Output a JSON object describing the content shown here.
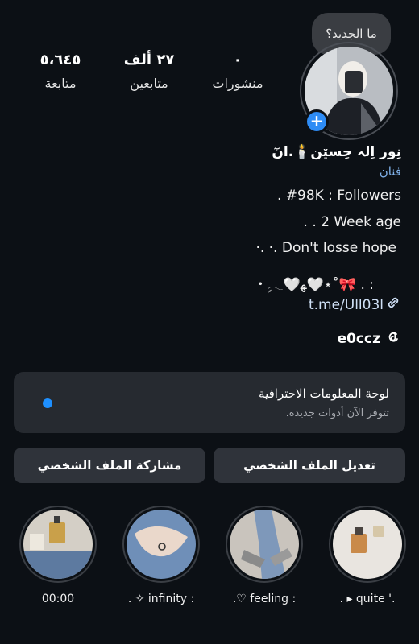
{
  "note": {
    "text": "ما الجديد؟"
  },
  "stats": [
    {
      "value": "٥،٦٤٥",
      "label": "متابعة"
    },
    {
      "value": "٢٧ ألف",
      "label": "متابعين"
    },
    {
      "value": "٠",
      "label": "منشورات"
    }
  ],
  "profile": {
    "name": "نِور اِلہ حِسێن🕯️.انٓ",
    "category": "فنان",
    "bio": [
      ".    #98K : Followers",
      ".             . 2 Week age",
      "·.               ·. Don't losse hope",
      "・ࣲ𓂃🤍ﻬ🤍⋆˚🎀 . :"
    ],
    "link": "t.me/Ull03l",
    "threads_handle": "e0ccz"
  },
  "dashboard": {
    "title": "لوحة المعلومات الاحترافية",
    "subtitle": "تتوفر الآن أدوات جديدة."
  },
  "buttons": {
    "edit": "تعديل الملف الشخصي",
    "share": "مشاركة الملف الشخصي"
  },
  "highlights": [
    {
      "label": "00:00"
    },
    {
      "label": ". ✧ infinity :"
    },
    {
      "label": ".♡ feeling :"
    },
    {
      "label": ". ▸ quite '."
    }
  ],
  "icons": {
    "add_story": "plus-icon",
    "link": "link-icon",
    "threads": "threads-icon"
  },
  "colors": {
    "background": "#0c1015",
    "accent": "#2e8cf5",
    "link": "#7fb0e8"
  }
}
